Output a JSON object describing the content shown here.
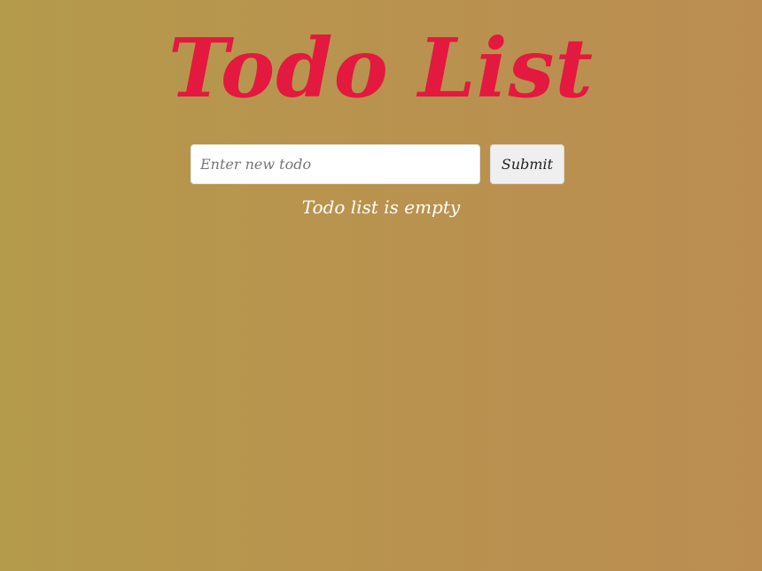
{
  "app": {
    "title": "Todo List"
  },
  "form": {
    "input_placeholder": "Enter new todo",
    "input_value": "",
    "submit_label": "Submit"
  },
  "list": {
    "empty_message": "Todo list is empty"
  },
  "colors": {
    "title": "#e3193f",
    "background_start": "#b49a4b",
    "background_end": "#bb8d51",
    "empty_message": "#ffffff"
  }
}
